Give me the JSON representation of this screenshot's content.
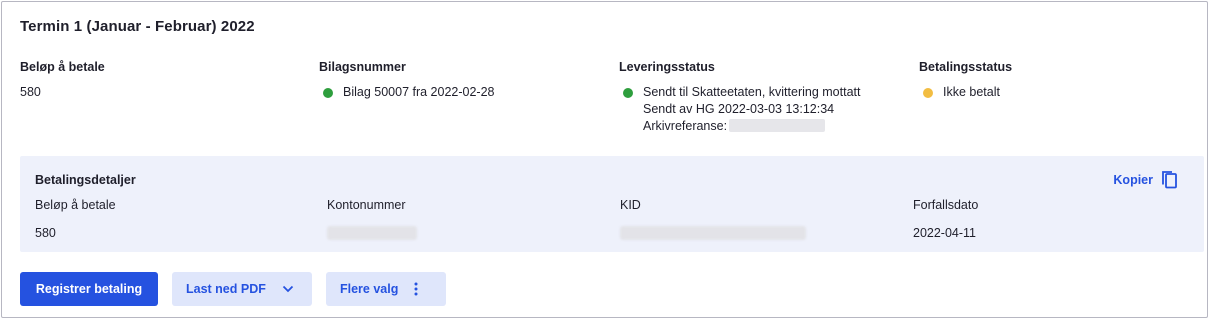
{
  "header": {
    "title": "Termin 1 (Januar - Februar) 2022"
  },
  "summary": {
    "amount": {
      "label": "Beløp å betale",
      "value": "580"
    },
    "voucher": {
      "label": "Bilagsnummer",
      "value": "Bilag 50007 fra 2022-02-28",
      "status_color": "#2e9e3d"
    },
    "delivery": {
      "label": "Leveringsstatus",
      "line1": "Sendt til Skatteetaten, kvittering mottatt",
      "line2": "Sendt av HG 2022-03-03 13:12:34",
      "line3": "Arkivreferanse:",
      "status_color": "#2e9e3d"
    },
    "payment": {
      "label": "Betalingsstatus",
      "value": "Ikke betalt",
      "status_color": "#f2bd42"
    }
  },
  "details": {
    "title": "Betalingsdetaljer",
    "copy_label": "Kopier",
    "copy_icon": "copy-icon",
    "amount": {
      "label": "Beløp å betale",
      "value": "580"
    },
    "account": {
      "label": "Kontonummer"
    },
    "kid": {
      "label": "KID"
    },
    "due": {
      "label": "Forfallsdato",
      "value": "2022-04-11"
    }
  },
  "actions": {
    "register": "Registrer betaling",
    "pdf": "Last ned PDF",
    "pdf_icon": "chevron-down-icon",
    "more": "Flere valg",
    "more_icon": "kebab-menu-icon"
  },
  "colors": {
    "accent": "#2552e0",
    "details_bg": "#eef1fb",
    "secondary_btn_bg": "#dfe6fb"
  }
}
